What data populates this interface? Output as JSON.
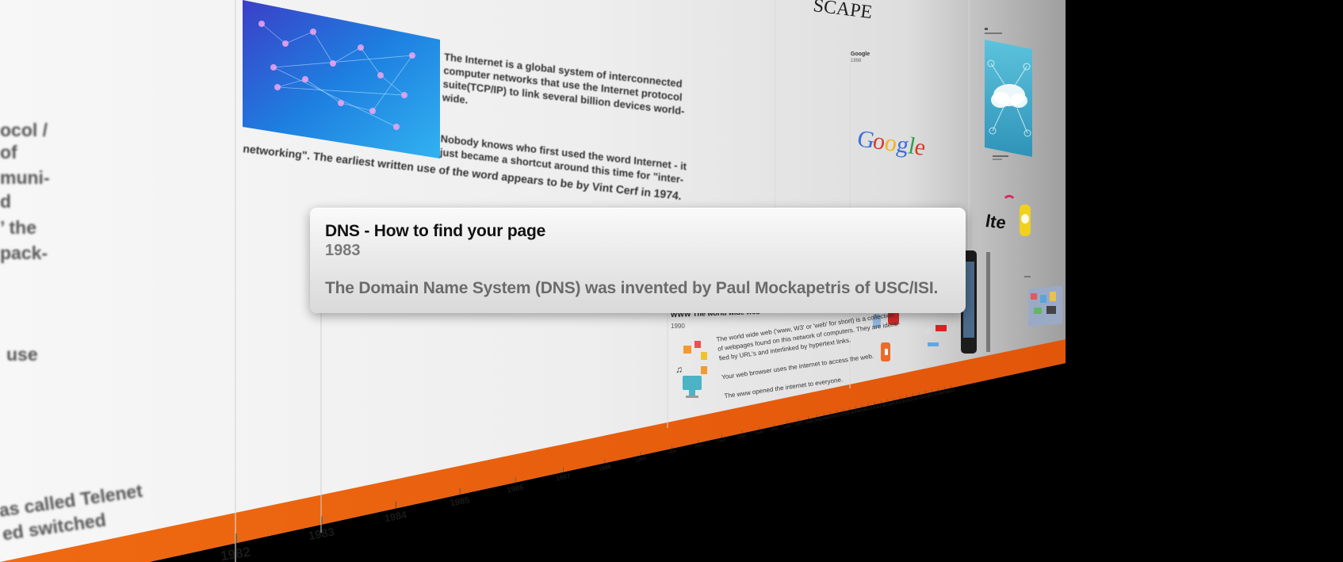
{
  "tooltip": {
    "title": "DNS - How to find your page",
    "year": "1983",
    "description": "The Domain Name System (DNS) was invented by Paul Mockapetris of USC/ISI."
  },
  "left_panel": {
    "lines_top": [
      "ocol /",
      "of",
      "muni-",
      "d",
      "’ the",
      "pack-"
    ],
    "line_use": "use",
    "lines_bottom": [
      "as called Telenet",
      "ed switched"
    ]
  },
  "internet_card": {
    "paragraph_1": [
      "The Internet is a global system of interconnected",
      "computer networks that use the Internet protocol",
      "suite(TCP/IP) to link several billion devices world-",
      "wide."
    ],
    "paragraph_2": [
      "Nobody knows who first used the word Internet - it",
      "just became a shortcut around this time for \"inter-"
    ],
    "tail": [
      "networking\". The earliest written use of the word appears to be by Vint Cerf in 1974."
    ]
  },
  "www_card": {
    "title": "WWW The world wide web",
    "year": "1990",
    "text": [
      "The world wide web ('www, W3' or 'web' for short) is a collection",
      "of webpages found on this network of computers. They are identi-",
      "fied by URL's and interlinked by hypertext links.",
      "",
      "Your web browser uses the internet to access the web.",
      "",
      "The www opened the internet to everyone."
    ]
  },
  "netscape_heading": "SCAPE",
  "google_card": {
    "label": "Google",
    "year": "1998",
    "logo_letters": [
      "G",
      "o",
      "o",
      "g",
      "l",
      "e"
    ]
  },
  "lte_logo": "lte",
  "timeline_years": [
    "1982",
    "1983",
    "1984",
    "1985",
    "1986",
    "1987",
    "1988",
    "1989",
    "1990",
    "1991",
    "1992",
    "1993",
    "1994",
    "1995",
    "1996",
    "1997",
    "1998",
    "1999",
    "2000",
    "2001",
    "2002",
    "2003",
    "2004",
    "2005",
    "2006",
    "2007",
    "2008",
    "2009",
    "2010",
    "2011",
    "2012",
    "2013",
    "2014",
    "2015",
    "2016",
    "2017",
    "2018",
    "2019",
    "2020"
  ],
  "colors": {
    "timeline_orange": "#e8600f",
    "page_background": "#f3f3f3",
    "backdrop": "#000000",
    "google": [
      "#3b6fd8",
      "#d93a2b",
      "#f2b21b",
      "#3b6fd8",
      "#2f9d48",
      "#d93a2b"
    ]
  }
}
